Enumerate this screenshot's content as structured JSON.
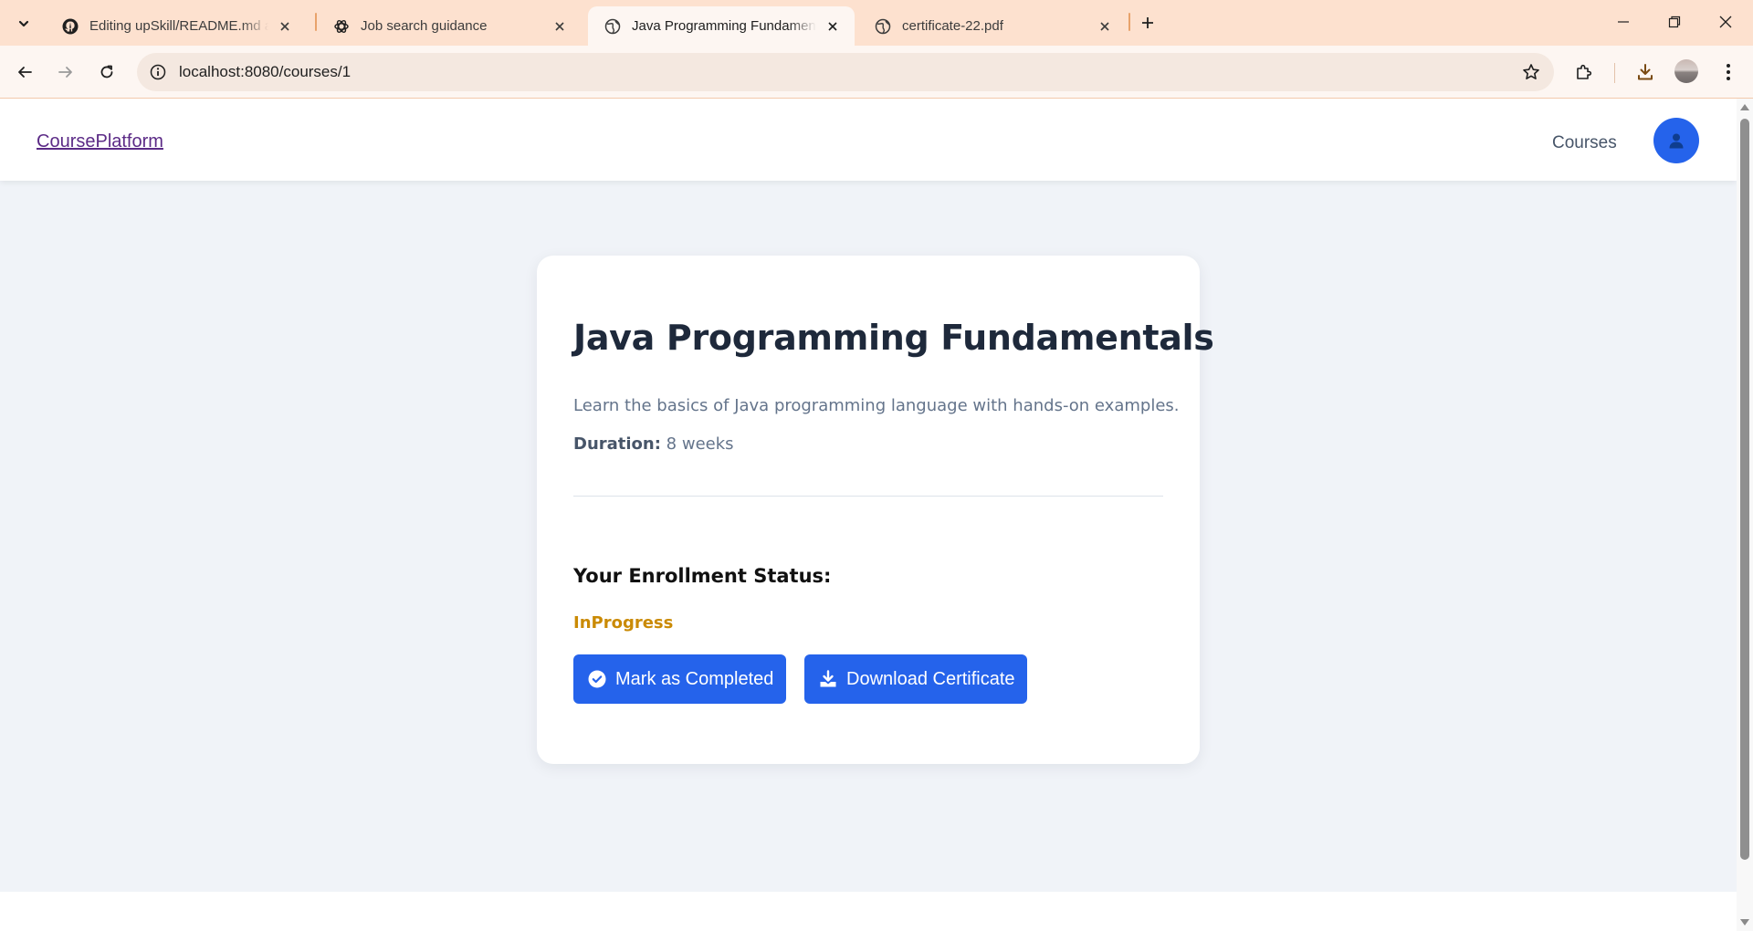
{
  "browser": {
    "tabs": [
      {
        "title": "Editing upSkill/README.md at main",
        "icon": "github-icon"
      },
      {
        "title": "Job search guidance",
        "icon": "chatgpt-icon"
      },
      {
        "title": "Java Programming Fundamentals",
        "icon": "globe-icon",
        "active": true
      },
      {
        "title": "certificate-22.pdf",
        "icon": "globe-icon"
      }
    ],
    "url": "localhost:8080/courses/1"
  },
  "navbar": {
    "brand": "CoursePlatform",
    "links": [
      "Courses"
    ],
    "avatar_icon": "user-icon"
  },
  "course": {
    "title": "Java Programming Fundamentals",
    "description": "Learn the basics of Java programming language with hands-on examples.",
    "duration_label": "Duration:",
    "duration_value": "8 weeks"
  },
  "enrollment": {
    "heading": "Your Enrollment Status:",
    "status": "InProgress"
  },
  "actions": {
    "complete_label": "Mark as Completed",
    "download_label": "Download Certificate"
  },
  "colors": {
    "primary": "#2563eb",
    "status_in_progress": "#ca8a04",
    "page_background": "#f0f3f8",
    "browser_frame": "#fde1cf"
  }
}
